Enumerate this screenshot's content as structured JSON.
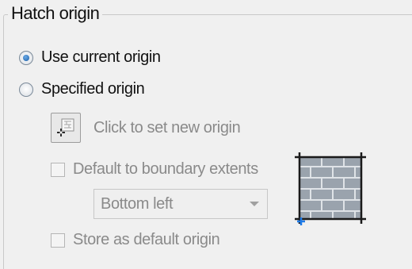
{
  "group": {
    "title": "Hatch origin"
  },
  "origin_mode": {
    "use_current_label": "Use current origin",
    "specified_label": "Specified origin",
    "selected": "use_current"
  },
  "specified": {
    "click_to_set_label": "Click to set new origin",
    "default_to_boundary_label": "Default to boundary extents",
    "default_to_boundary_checked": false,
    "boundary_position": {
      "selected": "Bottom left"
    },
    "store_default_label": "Store as default origin",
    "store_default_checked": false
  },
  "icons": {
    "set_origin": "pick-point-icon",
    "preview": "hatch-origin-preview-icon",
    "dropdown": "chevron-down-icon"
  },
  "colors": {
    "origin_marker": "#1e7be8",
    "hatch_fill": "#9aa3ad",
    "radio_selected": "#1b5fa8"
  }
}
